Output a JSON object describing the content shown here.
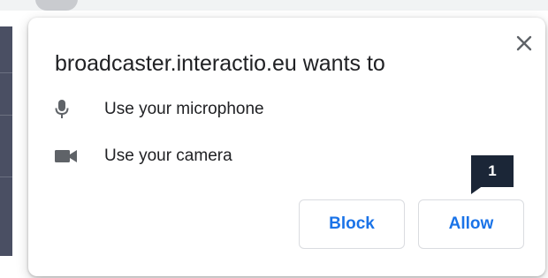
{
  "dialog": {
    "title": "broadcaster.interactio.eu wants to",
    "permissions": [
      {
        "icon": "microphone-icon",
        "label": "Use your microphone"
      },
      {
        "icon": "camera-icon",
        "label": "Use your camera"
      }
    ],
    "block_label": "Block",
    "allow_label": "Allow"
  },
  "annotation": {
    "step_number": "1"
  },
  "colors": {
    "accent": "#1a73e8",
    "text": "#202124",
    "icon": "#5f6368",
    "callout": "#1b2637"
  }
}
